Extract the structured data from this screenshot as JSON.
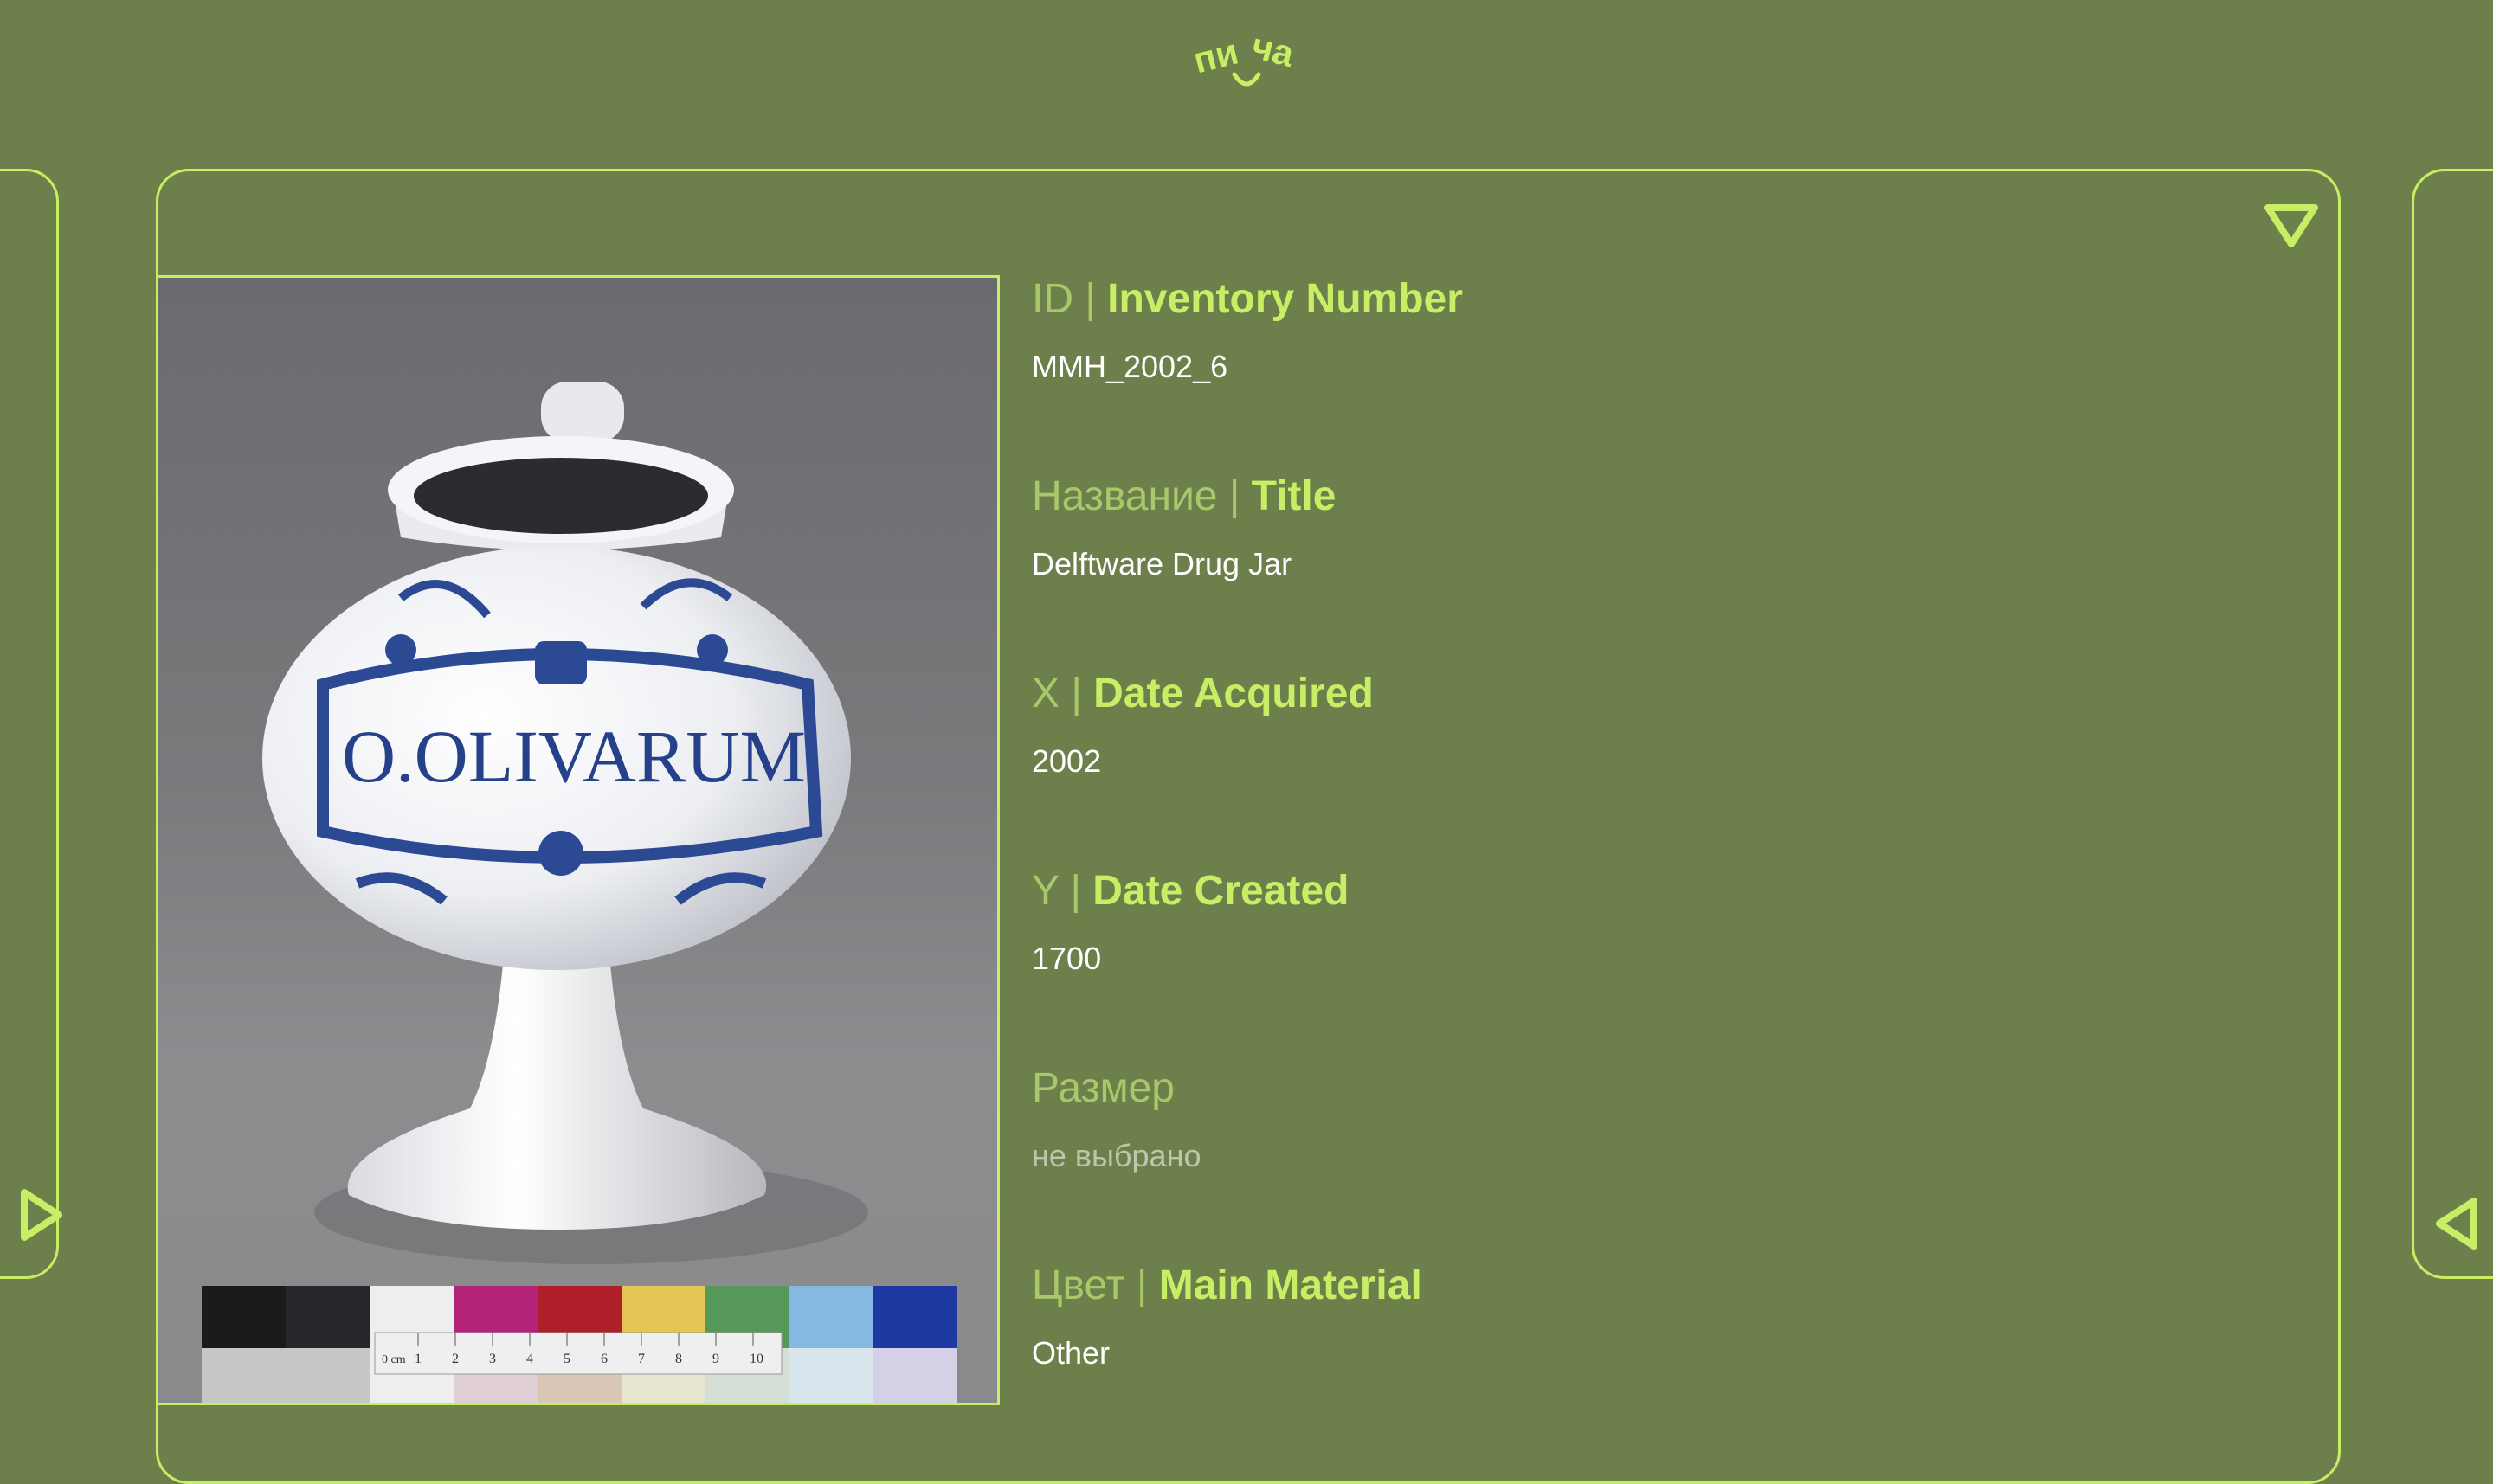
{
  "logo": {
    "text_top_left": "пи",
    "text_top_right": "ча",
    "icon": "smile-logo-icon"
  },
  "colors": {
    "background": "#6d804c",
    "accent": "#c7ee64",
    "label_muted": "#a9c86a",
    "value": "#ffffff",
    "placeholder": "#bcc6ac"
  },
  "nav": {
    "prev_icon": "triangle-right-icon",
    "next_icon": "triangle-left-icon",
    "collapse_icon": "triangle-down-icon"
  },
  "artwork": {
    "inscription": "O.OLIVARUM",
    "ruler_unit": "0 cm",
    "ruler_ticks": [
      "1",
      "2",
      "3",
      "4",
      "5",
      "6",
      "7",
      "8",
      "9",
      "10"
    ]
  },
  "fields": [
    {
      "ru": "ID",
      "sep": " | ",
      "en": "Inventory Number",
      "value": "MMH_2002_6"
    },
    {
      "ru": "Название",
      "sep": " | ",
      "en": "Title",
      "value": "Delftware Drug Jar"
    },
    {
      "ru": "X",
      "sep": " | ",
      "en": "Date Acquired",
      "value": "2002"
    },
    {
      "ru": "Y",
      "sep": " | ",
      "en": "Date Created",
      "value": "1700"
    },
    {
      "ru": "Размер",
      "sep": "",
      "en": "",
      "value": "не выбрано",
      "placeholder": true
    },
    {
      "ru": "Цвет",
      "sep": " | ",
      "en": "Main Material",
      "value": "Other"
    }
  ]
}
